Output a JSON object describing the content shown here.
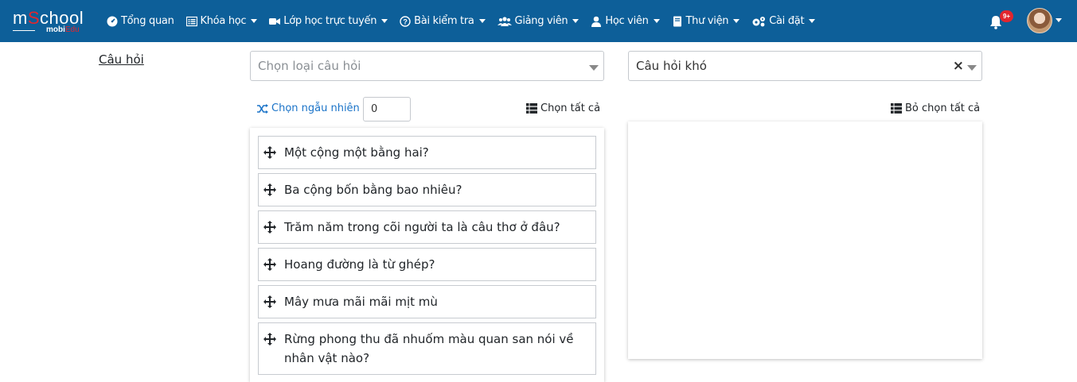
{
  "brand": {
    "logo_text_a": "m",
    "logo_text_b": "S",
    "logo_text_c": "chool",
    "logo_sub_a": "mobi",
    "logo_sub_b": "Edu"
  },
  "nav": [
    {
      "label": "Tổng quan",
      "icon": "dashboard-icon",
      "has_caret": false
    },
    {
      "label": "Khóa học",
      "icon": "course-list-icon",
      "has_caret": true
    },
    {
      "label": "Lớp học trực tuyến",
      "icon": "video-camera-icon",
      "has_caret": true
    },
    {
      "label": "Bài kiểm tra",
      "icon": "question-circle-icon",
      "has_caret": true
    },
    {
      "label": "Giảng viên",
      "icon": "users-icon",
      "has_caret": true
    },
    {
      "label": "Học viên",
      "icon": "user-icon",
      "has_caret": true
    },
    {
      "label": "Thư viện",
      "icon": "book-icon",
      "has_caret": true
    },
    {
      "label": "Cài đặt",
      "icon": "cogs-icon",
      "has_caret": true
    }
  ],
  "notifications": {
    "badge": "9+"
  },
  "content": {
    "label": "Câu hỏi",
    "type_select": {
      "placeholder": "Chọn loại câu hỏi"
    },
    "level_select": {
      "value": "Câu hỏi khó",
      "clear": "×"
    },
    "random_link": "Chọn ngẫu nhiên",
    "random_count": "0",
    "select_all": "Chọn tất cả",
    "deselect_all": "Bỏ chọn tất cả",
    "questions": [
      "Một cộng một bằng hai?",
      "Ba cộng bốn bằng bao nhiêu?",
      "Trăm năm trong cõi người ta là câu thơ ở đâu?",
      "Hoang đường là từ ghép?",
      "Mây mưa mãi mãi mịt mù",
      "Rừng phong thu đã nhuốm màu quan san nói về nhân vật nào?"
    ]
  },
  "colors": {
    "navbar": "#0d5f99",
    "accent": "#1a73c8",
    "brand_red": "#e2262e"
  }
}
